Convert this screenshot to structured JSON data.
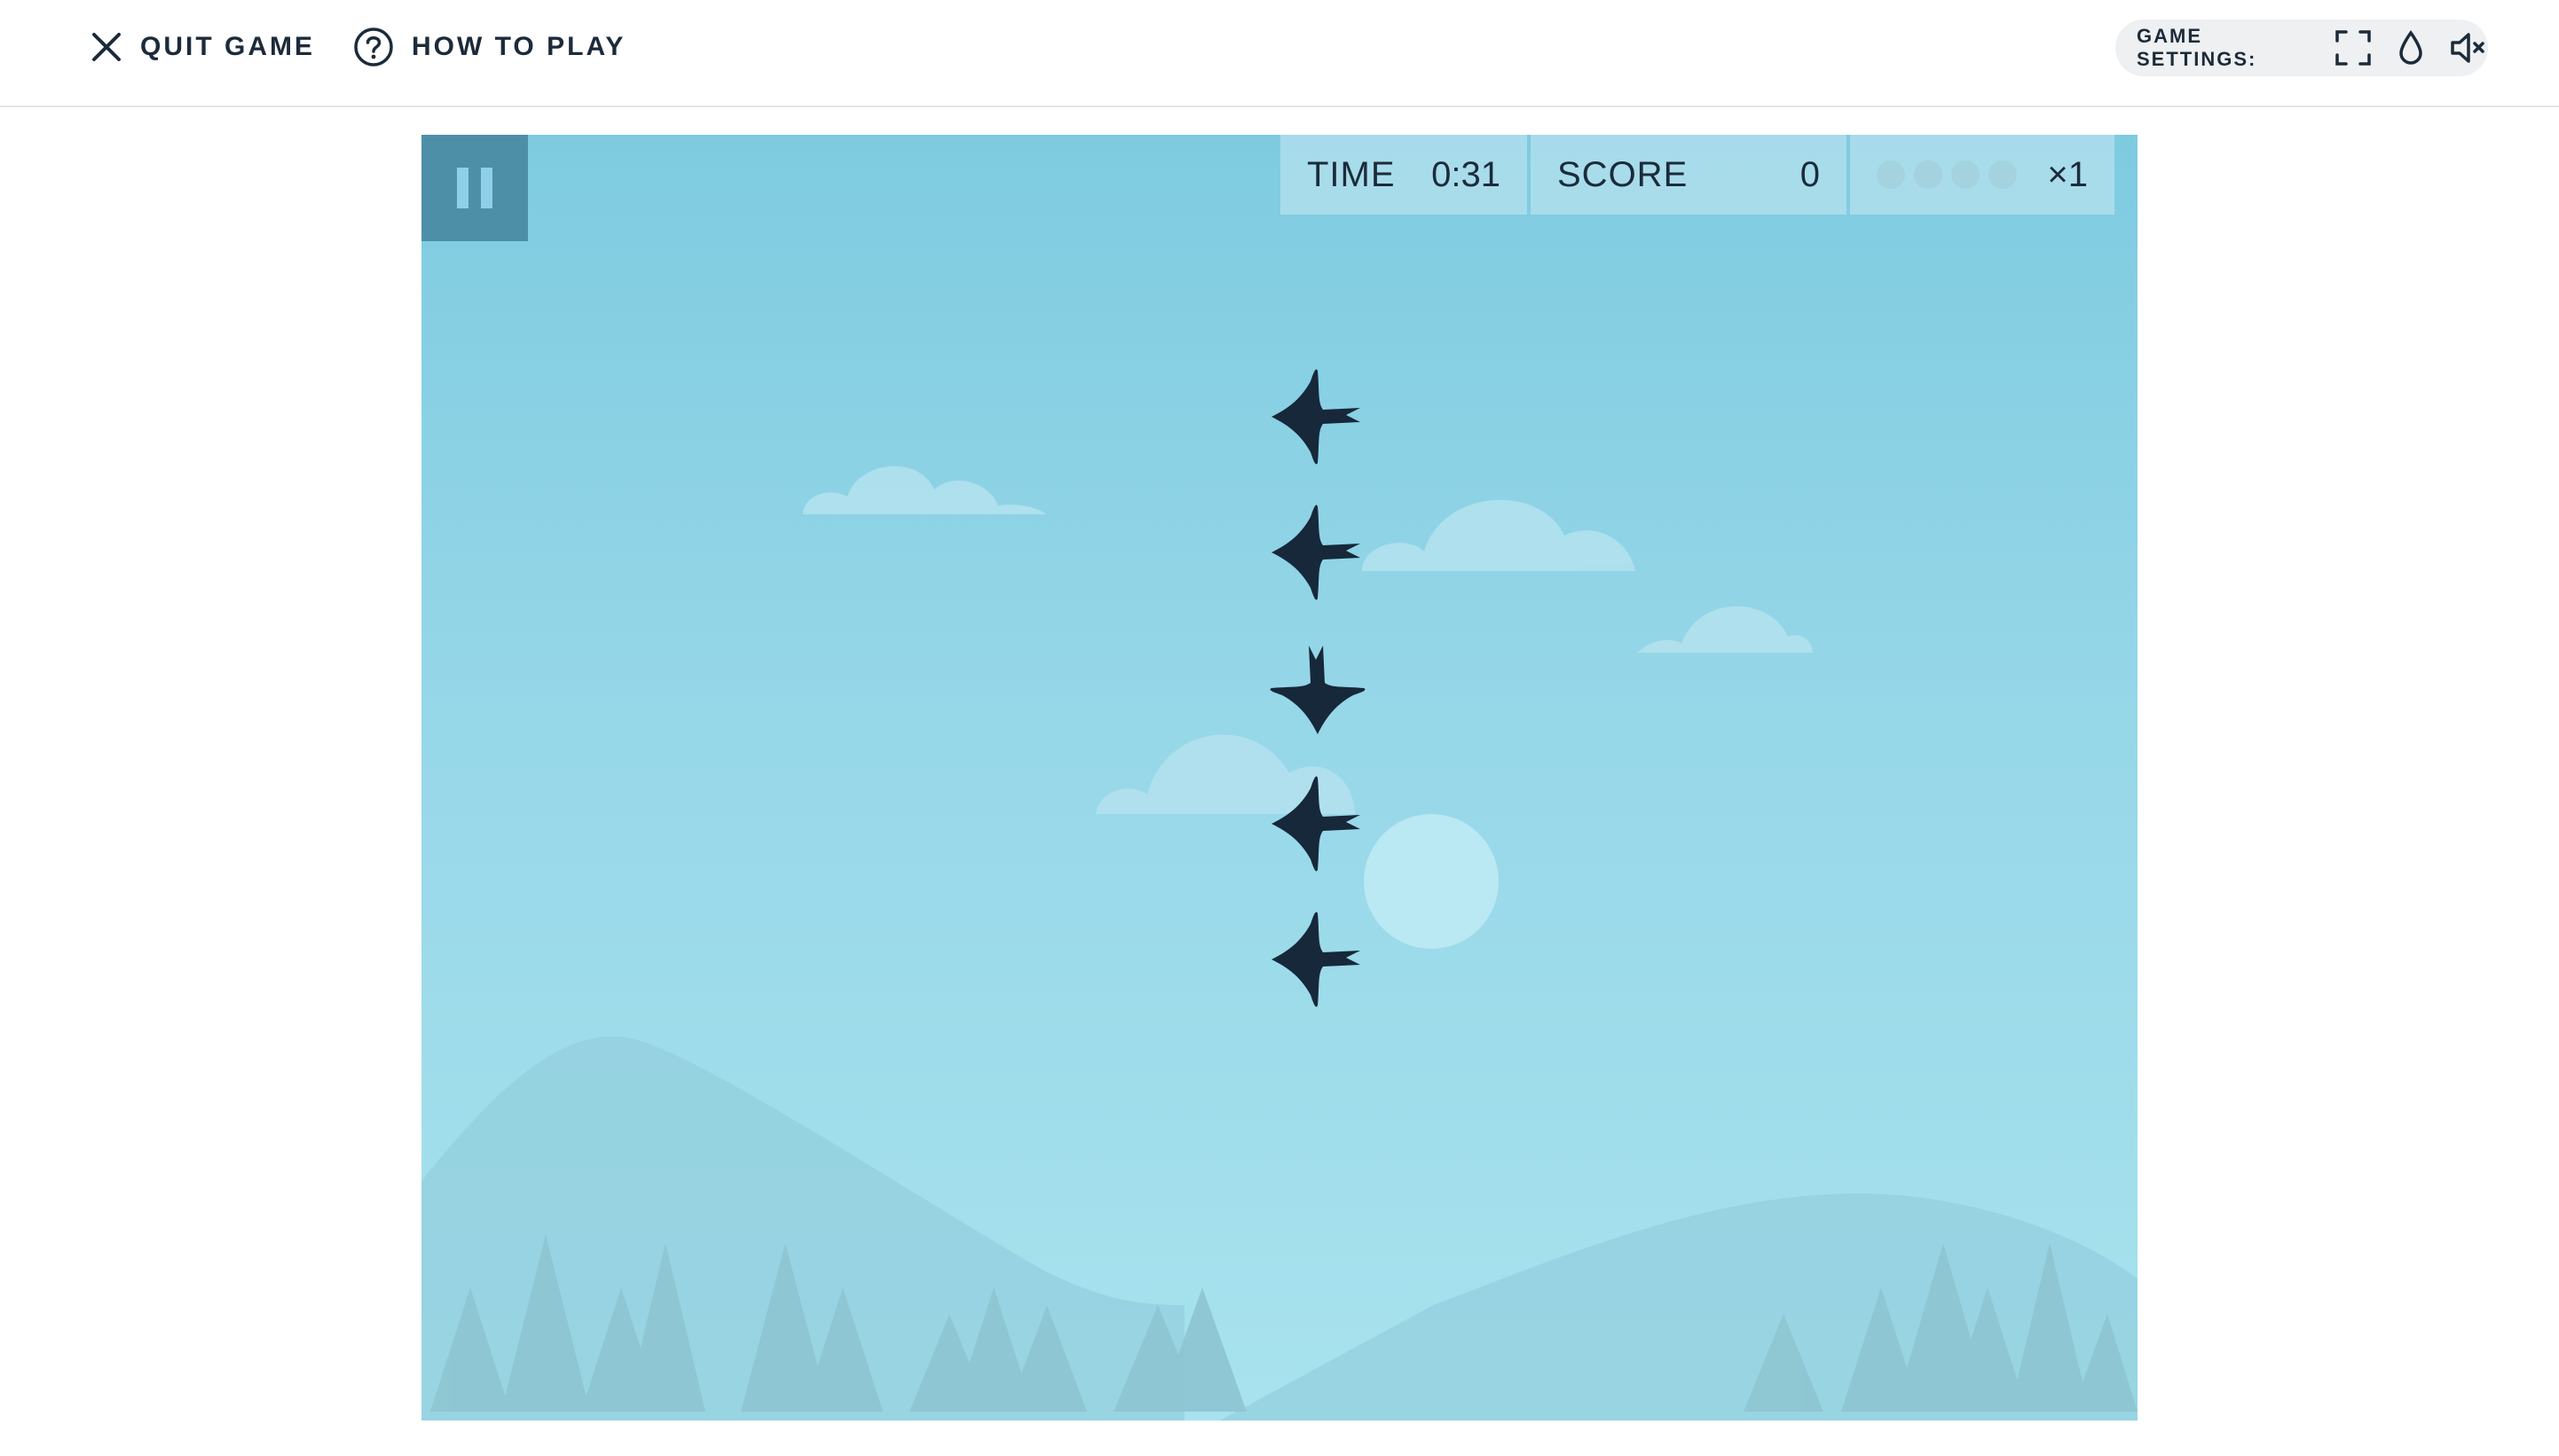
{
  "topbar": {
    "quit_label": "QUIT GAME",
    "howto_label": "HOW TO PLAY",
    "settings_label": "GAME SETTINGS:"
  },
  "hud": {
    "time_label": "TIME",
    "time_value": "0:31",
    "score_label": "SCORE",
    "score_value": "0",
    "multiplier": "×1",
    "streak_dots_total": 4,
    "streak_dots_filled": 0
  },
  "birds": [
    {
      "direction": "left"
    },
    {
      "direction": "left"
    },
    {
      "direction": "down"
    },
    {
      "direction": "left"
    },
    {
      "direction": "left"
    }
  ],
  "colors": {
    "text_dark": "#1c2b3a",
    "sky": "#8fd3e6",
    "bird": "#16283a",
    "pause_bg": "#4e8fa8"
  },
  "icons": [
    "close-icon",
    "help-circle-icon",
    "fullscreen-icon",
    "contrast-drop-icon",
    "sound-muted-icon",
    "pause-icon"
  ]
}
